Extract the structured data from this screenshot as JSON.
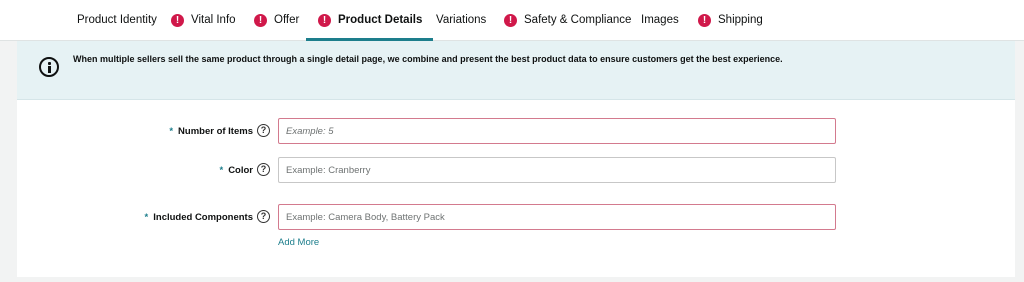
{
  "tabs": [
    {
      "label": "Product Identity",
      "error": false,
      "active": false
    },
    {
      "label": "Vital Info",
      "error": true,
      "active": false
    },
    {
      "label": "Offer",
      "error": true,
      "active": false
    },
    {
      "label": "Product Details",
      "error": true,
      "active": true
    },
    {
      "label": "Variations",
      "error": false,
      "active": false
    },
    {
      "label": "Safety & Compliance",
      "error": true,
      "active": false
    },
    {
      "label": "Images",
      "error": false,
      "active": false
    },
    {
      "label": "Shipping",
      "error": true,
      "active": false
    }
  ],
  "error_icon_glyph": "!",
  "help_icon_glyph": "?",
  "required_marker": "*",
  "banner": {
    "icon": "info-icon",
    "text": "When multiple sellers sell the same product through a single detail page, we combine and present the best product data to ensure customers get the best experience."
  },
  "fields": [
    {
      "label": "Number of Items",
      "required": true,
      "placeholder": "Example: 5",
      "value": "",
      "error": true
    },
    {
      "label": "Color",
      "required": true,
      "placeholder": "Example: Cranberry",
      "value": "",
      "error": false
    },
    {
      "label": "Included Components",
      "required": true,
      "placeholder": "Example: Camera Body, Battery Pack",
      "value": "",
      "error": true
    }
  ],
  "add_more_label": "Add More",
  "colors": {
    "accent": "#1d7e8c",
    "error": "#d0184a",
    "banner_bg": "#e6f2f4"
  }
}
